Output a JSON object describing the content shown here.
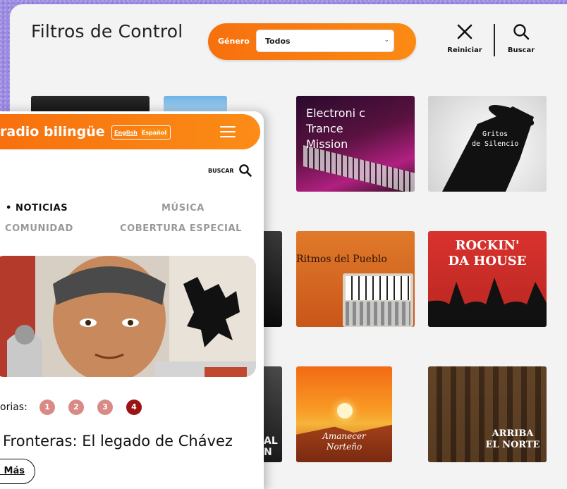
{
  "filters": {
    "title": "Filtros de Control",
    "genre_label": "Género",
    "genre_value": "Todos",
    "reset_label": "Reiniciar",
    "search_label": "Buscar"
  },
  "albums": [
    {
      "title": "Electroni c\nTrance\nMission"
    },
    {
      "title": "Gritos\nde Silencio"
    },
    {
      "title": "Ritmos del Pueblo"
    },
    {
      "title": "ROCKIN'\nDA HOUSE"
    },
    {
      "title": "Amanecer\nNorteño"
    },
    {
      "title": "ARRIBA\nEL NORTE"
    },
    {
      "title": "AL\nN"
    }
  ],
  "colors": {
    "accent": "#f7700e",
    "accent_light": "#fb8c16",
    "dot_inactive": "#d98a86",
    "dot_active": "#9b1414"
  },
  "phone": {
    "brand": "radio bilingüe",
    "lang_en": "English",
    "lang_es": "Español",
    "search_label": "BUSCAR",
    "nav": {
      "noticias": "• NOTICIAS",
      "musica": "MÚSICA",
      "comunidad": "COMUNIDAD",
      "cobertura": "COBERTURA ESPECIAL"
    },
    "categories_label": "orias:",
    "pages": [
      "1",
      "2",
      "3",
      "4"
    ],
    "article_title": "Fronteras: El legado de Chávez",
    "read_more": "a Más"
  }
}
